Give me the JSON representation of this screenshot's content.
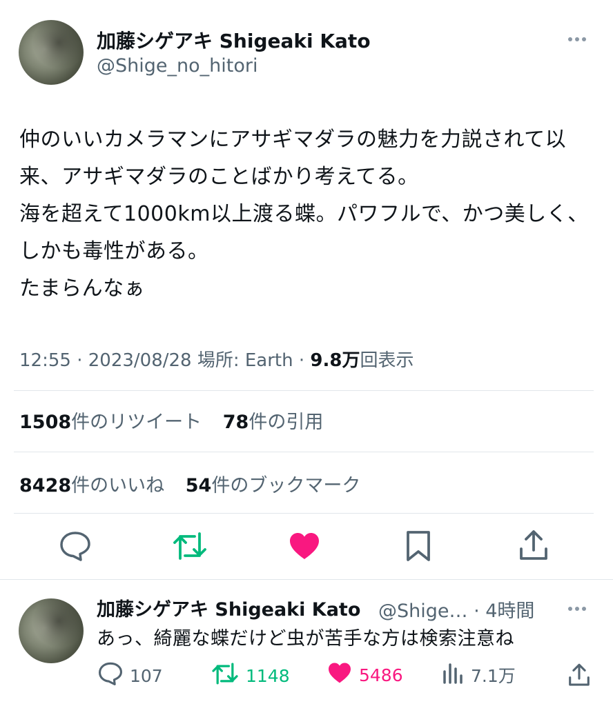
{
  "tweet": {
    "display_name": "加藤シゲアキ Shigeaki Kato",
    "handle": "@Shige_no_hitori",
    "body": "仲のいいカメラマンにアサギマダラの魅力を力説されて以来、アサギマダラのことばかり考えてる。\n海を超えて1000km以上渡る蝶。パワフルで、かつ美しく、しかも毒性がある。\nたまらんなぁ",
    "time": "12:55",
    "date": "2023/08/28",
    "location_label": "場所: Earth",
    "views_value": "9.8万",
    "views_label": "回表示",
    "retweets_count": "1508",
    "retweets_label": "件のリツイート",
    "quotes_count": "78",
    "quotes_label": "件の引用",
    "likes_count": "8428",
    "likes_label": "件のいいね",
    "bookmarks_count": "54",
    "bookmarks_label": "件のブックマーク"
  },
  "reply": {
    "display_name": "加藤シゲアキ Shigeaki Kato",
    "handle_time": "@Shige… · 4時間",
    "text": "あっ、綺麗な蝶だけど虫が苦手な方は検索注意ね",
    "reply_count": "107",
    "retweet_count": "1148",
    "like_count": "5486",
    "view_count": "7.1万"
  },
  "icons": {
    "reply": "speech-bubble-icon",
    "retweet": "retweet-arrows-icon",
    "like": "heart-icon",
    "bookmark": "bookmark-icon",
    "share": "share-upload-icon",
    "views": "bar-chart-icon",
    "more": "ellipsis-icon"
  },
  "colors": {
    "retweet": "#00ba7c",
    "like": "#f91880",
    "secondary_text": "#536471",
    "icon": "#536471"
  }
}
